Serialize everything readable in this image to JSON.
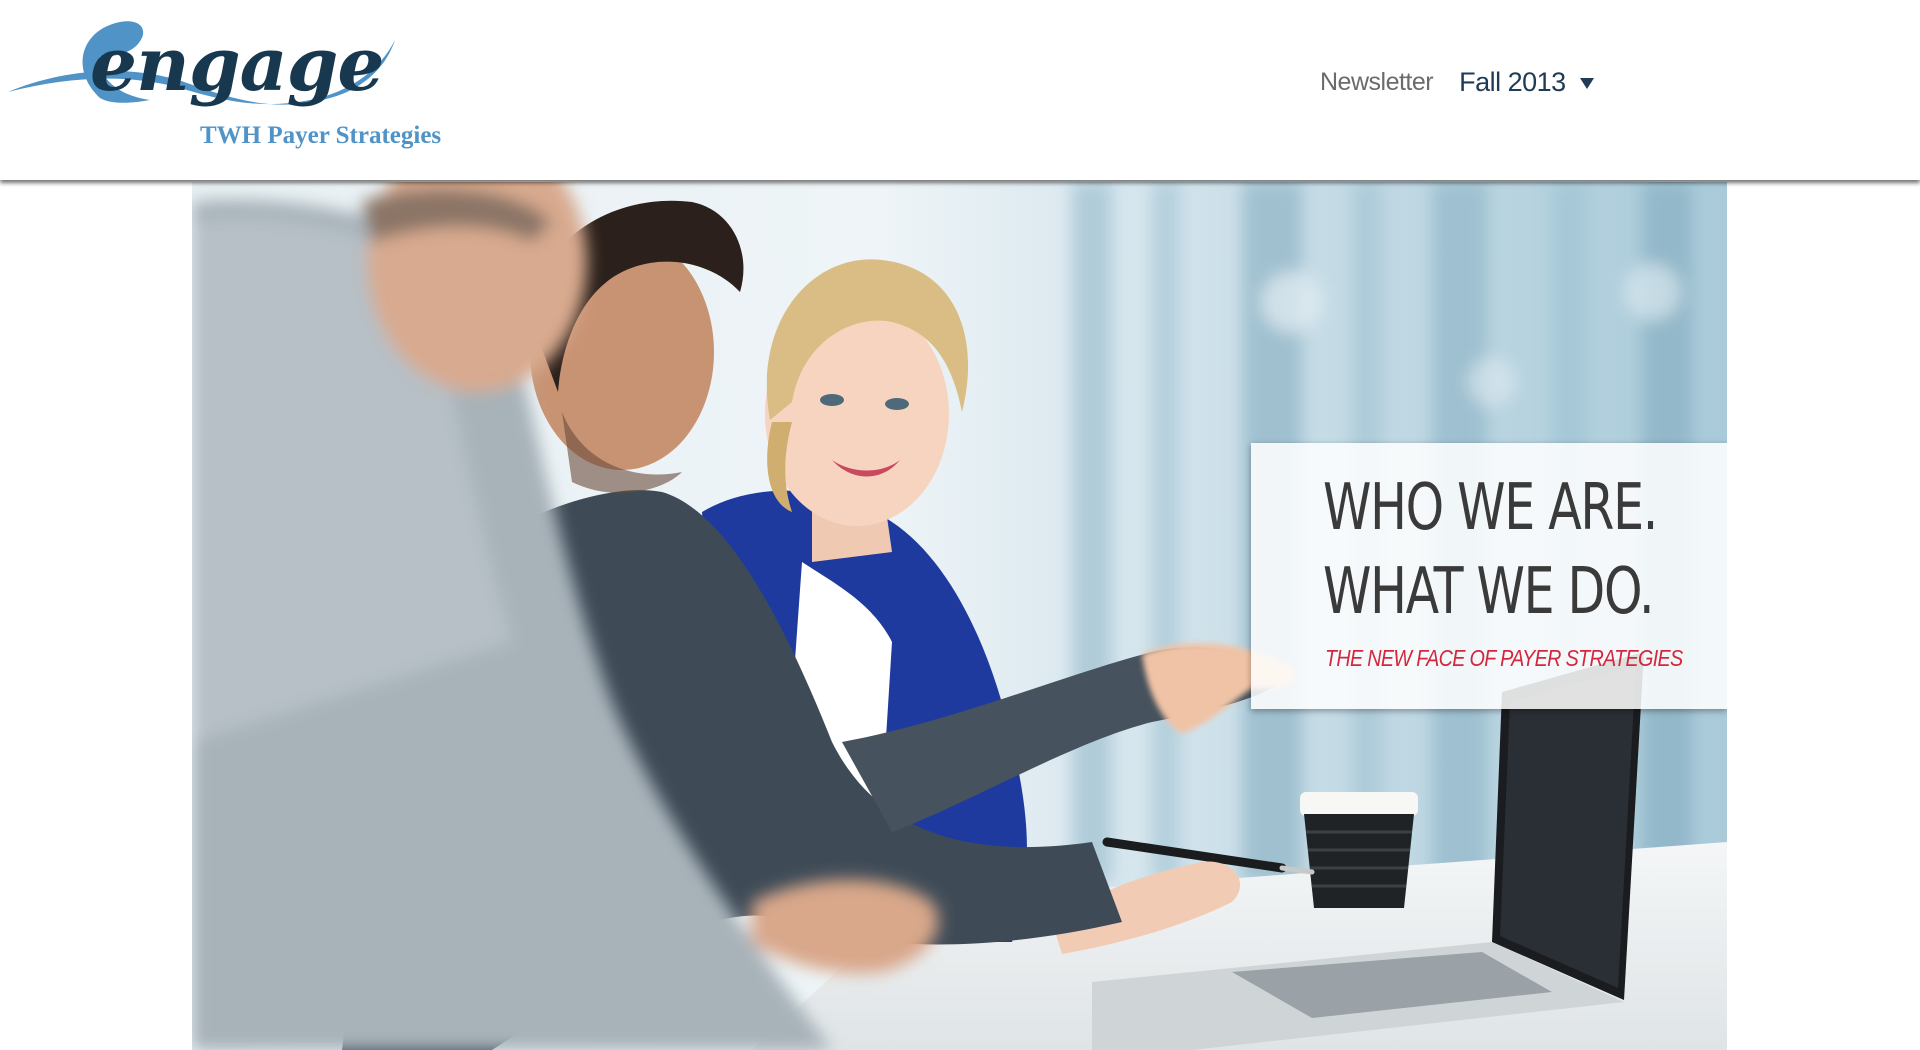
{
  "brand": {
    "logo_text": "engage",
    "subtitle": "TWH Payer Strategies"
  },
  "nav": {
    "label": "Newsletter",
    "issue": "Fall 2013",
    "issue_icon": "caret-down-icon"
  },
  "hero": {
    "headline_line1": "WHO WE ARE.",
    "headline_line2": "WHAT WE DO.",
    "tagline": "THE NEW FACE OF PAYER STRATEGIES"
  },
  "colors": {
    "brand_dark": "#17384f",
    "brand_blue": "#4f93c7",
    "accent_red": "#d3273d",
    "nav_text": "#1f3b55"
  }
}
